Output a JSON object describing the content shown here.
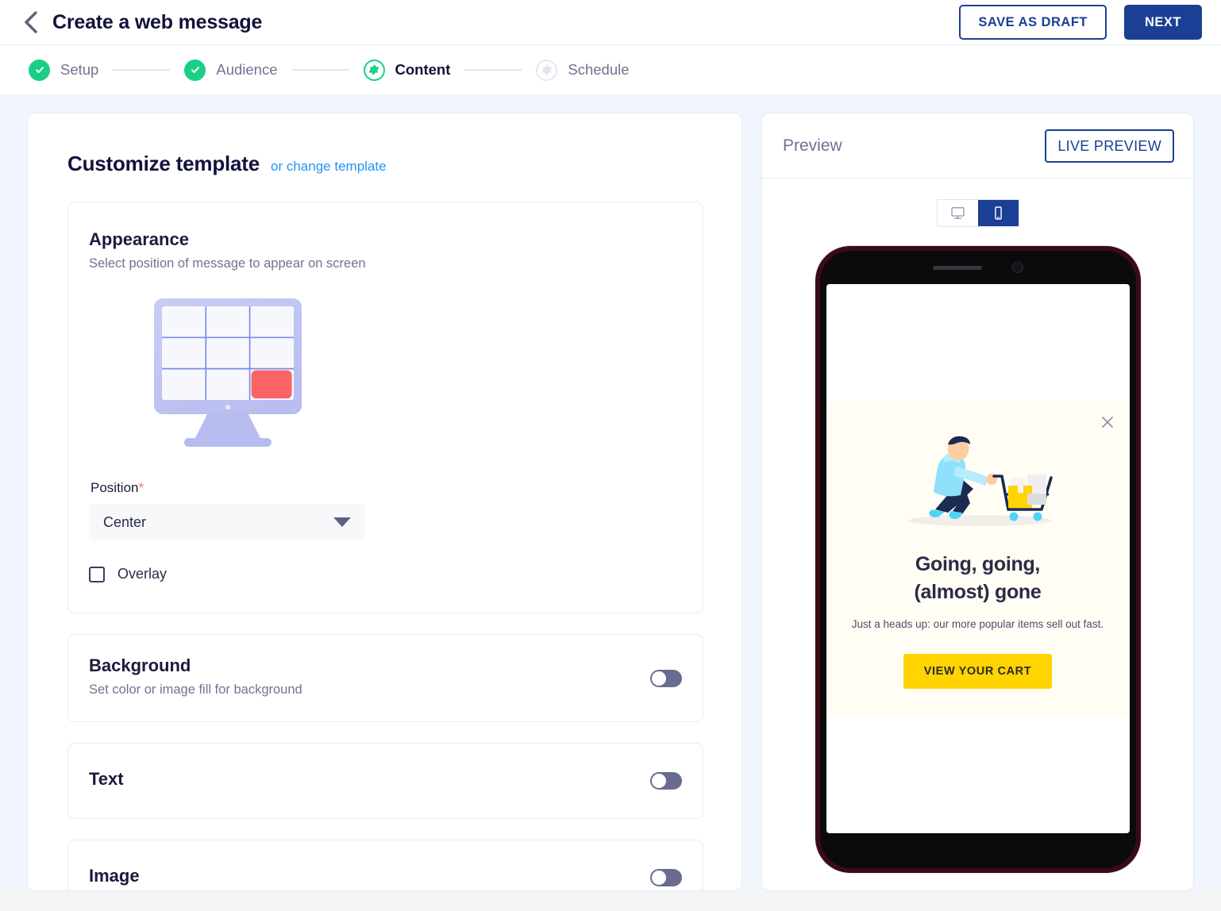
{
  "header": {
    "back_icon": "chevron-left-icon",
    "title": "Create a web message",
    "save_draft_label": "SAVE AS DRAFT",
    "next_label": "NEXT"
  },
  "stepper": {
    "steps": [
      {
        "label": "Setup",
        "state": "done",
        "icon": "check-icon"
      },
      {
        "label": "Audience",
        "state": "done",
        "icon": "check-icon"
      },
      {
        "label": "Content",
        "state": "current",
        "icon": "gear-icon"
      },
      {
        "label": "Schedule",
        "state": "todo",
        "icon": "gear-icon"
      }
    ]
  },
  "customize": {
    "title": "Customize template",
    "change_template_link": "or change template"
  },
  "appearance": {
    "title": "Appearance",
    "subtitle": "Select position of message to appear on screen",
    "illustration": "monitor-grid-illustration",
    "highlighted_cell": "bottom-right",
    "position_label": "Position",
    "position_required_marker": "*",
    "position_value": "Center",
    "position_options": [
      "Center"
    ],
    "overlay_label": "Overlay",
    "overlay_checked": false
  },
  "sections": [
    {
      "title": "Background",
      "subtitle": "Set color or image fill for background",
      "enabled": false
    },
    {
      "title": "Text",
      "subtitle": "",
      "enabled": false
    },
    {
      "title": "Image",
      "subtitle": "",
      "enabled": false
    }
  ],
  "preview": {
    "title": "Preview",
    "live_preview_label": "LIVE PREVIEW",
    "device_options": [
      {
        "name": "desktop",
        "icon": "desktop-icon",
        "active": false
      },
      {
        "name": "mobile",
        "icon": "mobile-icon",
        "active": true
      }
    ],
    "message": {
      "close_icon": "close-icon",
      "illustration": "person-pushing-shopping-cart-illustration",
      "title_line1": "Going, going,",
      "title_line2": "(almost) gone",
      "body": "Just a heads up: our more popular items sell out fast.",
      "cta_label": "VIEW YOUR CART"
    }
  },
  "colors": {
    "page_background": "#f1f5fd",
    "brand_navy": "#1b3f94",
    "accent_link": "#2196f3",
    "step_done_green": "#19cf86",
    "required_red": "#ff6b6b",
    "highlight_red": "#fa6464",
    "toggle_track": "#6a6b90",
    "cta_yellow": "#ffd400",
    "message_background": "#fffdf4"
  }
}
